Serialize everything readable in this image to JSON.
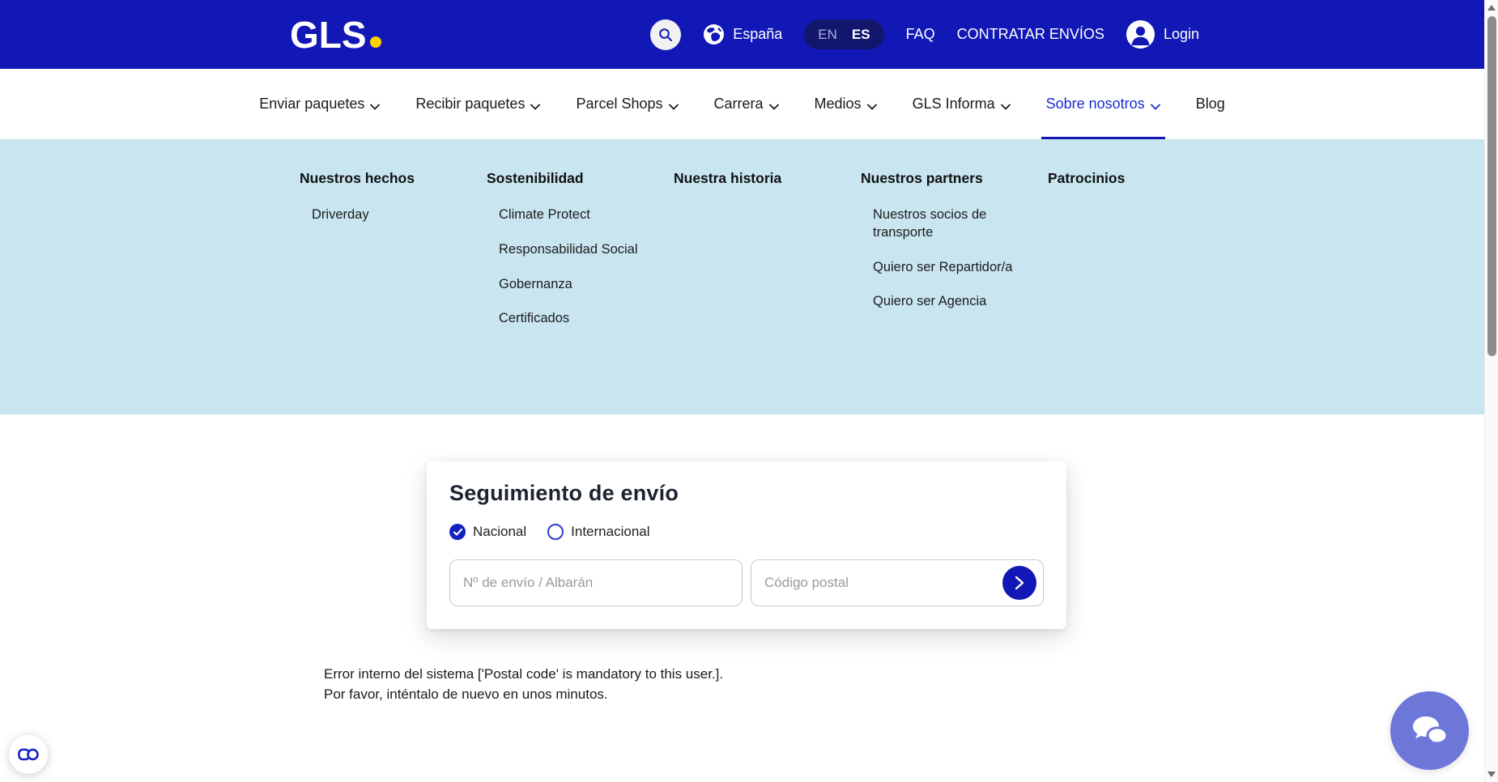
{
  "colors": {
    "header_blue": "#1118b5",
    "lang_pill_blue": "#12166d",
    "logo_dot_yellow": "#ffd100",
    "mega_menu_bg": "#c8e5f0",
    "active_nav_blue": "#1b2bce",
    "radio_selected_blue": "#1322c0",
    "chat_button_purple": "#6d77d8"
  },
  "header": {
    "logo_text": "GLS",
    "country": "España",
    "lang_en": "EN",
    "lang_es": "ES",
    "faq": "FAQ",
    "contract": "CONTRATAR ENVÍOS",
    "login": "Login"
  },
  "nav": {
    "items": [
      {
        "label": "Enviar paquetes",
        "has_dropdown": true,
        "active": false
      },
      {
        "label": "Recibir paquetes",
        "has_dropdown": true,
        "active": false
      },
      {
        "label": "Parcel Shops",
        "has_dropdown": true,
        "active": false
      },
      {
        "label": "Carrera",
        "has_dropdown": true,
        "active": false
      },
      {
        "label": "Medios",
        "has_dropdown": true,
        "active": false
      },
      {
        "label": "GLS Informa",
        "has_dropdown": true,
        "active": false
      },
      {
        "label": "Sobre nosotros",
        "has_dropdown": true,
        "active": true
      },
      {
        "label": "Blog",
        "has_dropdown": false,
        "active": false
      }
    ]
  },
  "mega_menu": {
    "columns": [
      {
        "header": "Nuestros hechos",
        "items": [
          "Driverday"
        ]
      },
      {
        "header": "Sostenibilidad",
        "items": [
          "Climate Protect",
          "Responsabilidad Social",
          "Gobernanza",
          "Certificados"
        ]
      },
      {
        "header": "Nuestra historia",
        "items": []
      },
      {
        "header": "Nuestros partners",
        "items": [
          "Nuestros socios de transporte",
          "Quiero ser Repartidor/a",
          "Quiero ser Agencia"
        ]
      },
      {
        "header": "Patrocinios",
        "items": []
      }
    ]
  },
  "tracking_card": {
    "title": "Seguimiento de envío",
    "radio_national": "Nacional",
    "radio_international": "Internacional",
    "national_selected": true,
    "tracking_placeholder": "Nº de envío / Albarán",
    "postal_placeholder": "Código postal"
  },
  "error": {
    "line1": "Error interno del sistema ['Postal code' is mandatory to this user.].",
    "line2": "Por favor, inténtalo de nuevo en unos minutos."
  }
}
